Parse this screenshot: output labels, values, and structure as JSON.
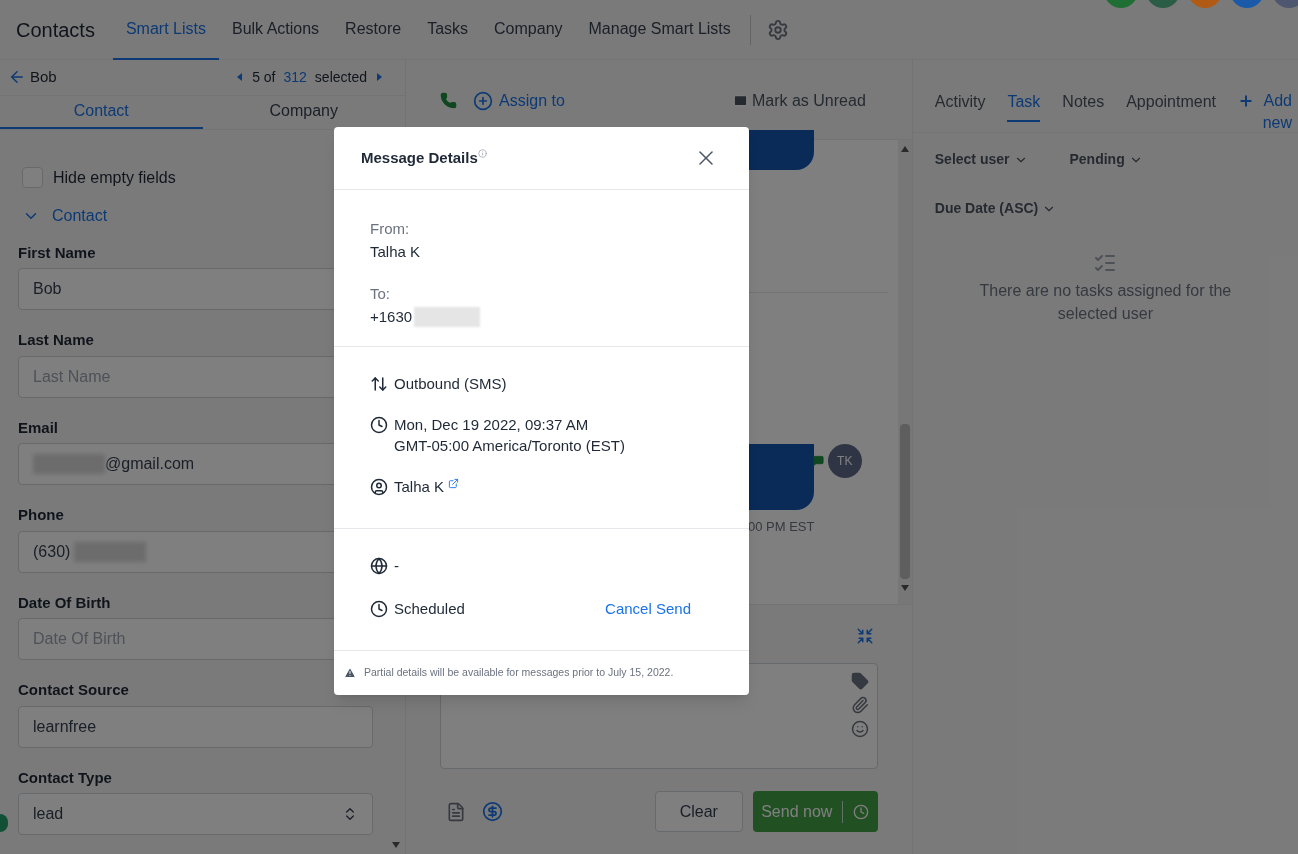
{
  "top_nav": {
    "title": "Contacts",
    "tabs": [
      {
        "label": "Smart Lists",
        "selected": true
      },
      {
        "label": "Bulk Actions",
        "selected": false
      },
      {
        "label": "Restore",
        "selected": false
      },
      {
        "label": "Tasks",
        "selected": false
      },
      {
        "label": "Company",
        "selected": false
      },
      {
        "label": "Manage Smart Lists",
        "selected": false
      }
    ]
  },
  "avatars": [
    {
      "color": "#1f6e34"
    },
    {
      "color": "#2b5c45"
    },
    {
      "color": "#b05a14"
    },
    {
      "color": "#1a5aa8"
    },
    {
      "color": "#4f5670"
    }
  ],
  "contact_header": {
    "name": "Bob",
    "position": "5 of",
    "total": "312",
    "suffix": "selected"
  },
  "left_tabs": [
    {
      "label": "Contact",
      "selected": true
    },
    {
      "label": "Company",
      "selected": false
    }
  ],
  "hide_empty": {
    "label": "Hide empty fields",
    "checked": false
  },
  "section": {
    "label": "Contact",
    "expanded": true
  },
  "fields": [
    {
      "label": "First Name",
      "kind": "text",
      "value": "Bob"
    },
    {
      "label": "Last Name",
      "kind": "text",
      "placeholder": "Last Name"
    },
    {
      "label": "Email",
      "kind": "text",
      "value": "@gmail.com",
      "blur_before": true
    },
    {
      "label": "Phone",
      "kind": "text",
      "value": "(630)",
      "blur_after": true
    },
    {
      "label": "Date Of Birth",
      "kind": "text",
      "placeholder": "Date Of Birth"
    },
    {
      "label": "Contact Source",
      "kind": "text",
      "value": "learnfree"
    },
    {
      "label": "Contact Type",
      "kind": "select",
      "value": "lead"
    }
  ],
  "conversation": {
    "assign": "Assign to",
    "mark_unread": "Mark as Unread",
    "timestamp": "00 PM EST",
    "avatar": "TK"
  },
  "composer": {
    "clear": "Clear",
    "send": "Send now"
  },
  "right_tabs": [
    {
      "label": "Activity",
      "selected": false
    },
    {
      "label": "Task",
      "selected": true
    },
    {
      "label": "Notes",
      "selected": false
    },
    {
      "label": "Appointment",
      "selected": false
    }
  ],
  "add_new": "Add new",
  "filters": [
    "Select user",
    "Pending",
    "Due Date (ASC)"
  ],
  "empty_message": "There are no tasks assigned for the selected user",
  "modal": {
    "title": "Message Details",
    "from_label": "From:",
    "from": "Talha K",
    "to_label": "To:",
    "to": "+1630",
    "details": [
      {
        "kind": "direction",
        "lines": [
          "Outbound (SMS)"
        ]
      },
      {
        "kind": "time",
        "lines": [
          "Mon, Dec 19 2022, 09:37 AM",
          "GMT-05:00 America/Toronto (EST)"
        ]
      },
      {
        "kind": "user",
        "lines": [
          "Talha K"
        ],
        "link": true
      }
    ],
    "status": [
      {
        "kind": "globe",
        "text": "-"
      },
      {
        "kind": "clock",
        "text": "Scheduled",
        "action": "Cancel Send"
      }
    ],
    "footer": "Partial details will be available for messages prior to July 15, 2022."
  }
}
